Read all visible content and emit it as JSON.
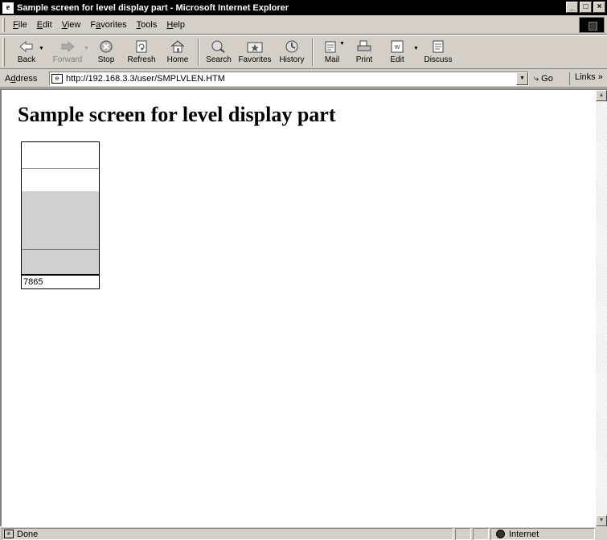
{
  "window": {
    "title": "Sample screen for level display part - Microsoft Internet Explorer",
    "controls": {
      "minimize": "_",
      "maximize": "□",
      "close": "×"
    }
  },
  "menu": {
    "items": [
      {
        "pre": "",
        "accel": "F",
        "post": "ile"
      },
      {
        "pre": "",
        "accel": "E",
        "post": "dit"
      },
      {
        "pre": "",
        "accel": "V",
        "post": "iew"
      },
      {
        "pre": "F",
        "accel": "a",
        "post": "vorites"
      },
      {
        "pre": "",
        "accel": "T",
        "post": "ools"
      },
      {
        "pre": "",
        "accel": "H",
        "post": "elp"
      }
    ]
  },
  "toolbar": {
    "back": "Back",
    "forward": "Forward",
    "stop": "Stop",
    "refresh": "Refresh",
    "home": "Home",
    "search": "Search",
    "favorites": "Favorites",
    "history": "History",
    "mail": "Mail",
    "print": "Print",
    "edit": "Edit",
    "discuss": "Discuss"
  },
  "address": {
    "label_pre": "A",
    "label_accel": "d",
    "label_post": "dress",
    "url": "http://192.168.3.3/user/SMPLVLEN.HTM",
    "go": "Go",
    "links": "Links »"
  },
  "page": {
    "heading": "Sample screen for level display part",
    "level_display": {
      "value": "7865",
      "fill_fraction": 0.63,
      "fill_color": "#d0d0d0"
    }
  },
  "status": {
    "text": "Done",
    "zone": "Internet"
  }
}
